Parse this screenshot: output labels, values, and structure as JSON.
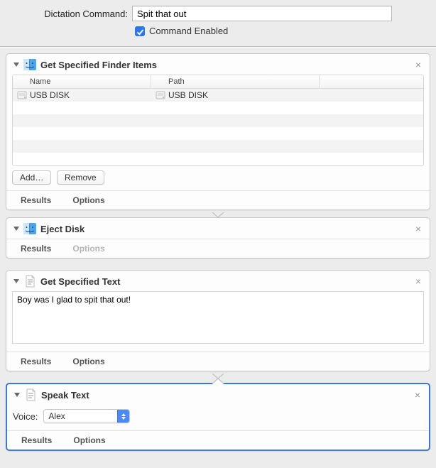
{
  "top": {
    "label": "Dictation Command:",
    "value": "Spit that out",
    "enabled_label": "Command Enabled",
    "enabled": true
  },
  "actions": {
    "finder": {
      "title": "Get Specified Finder Items",
      "columns": {
        "name": "Name",
        "path": "Path"
      },
      "rows": [
        {
          "name": "USB DISK",
          "path": "USB DISK"
        }
      ],
      "add": "Add…",
      "remove": "Remove",
      "results": "Results",
      "options": "Options"
    },
    "eject": {
      "title": "Eject Disk",
      "results": "Results",
      "options": "Options"
    },
    "gettext": {
      "title": "Get Specified Text",
      "text": "Boy was I glad to spit that out!",
      "results": "Results",
      "options": "Options"
    },
    "speak": {
      "title": "Speak Text",
      "voice_label": "Voice:",
      "voice_value": "Alex",
      "results": "Results",
      "options": "Options"
    }
  }
}
